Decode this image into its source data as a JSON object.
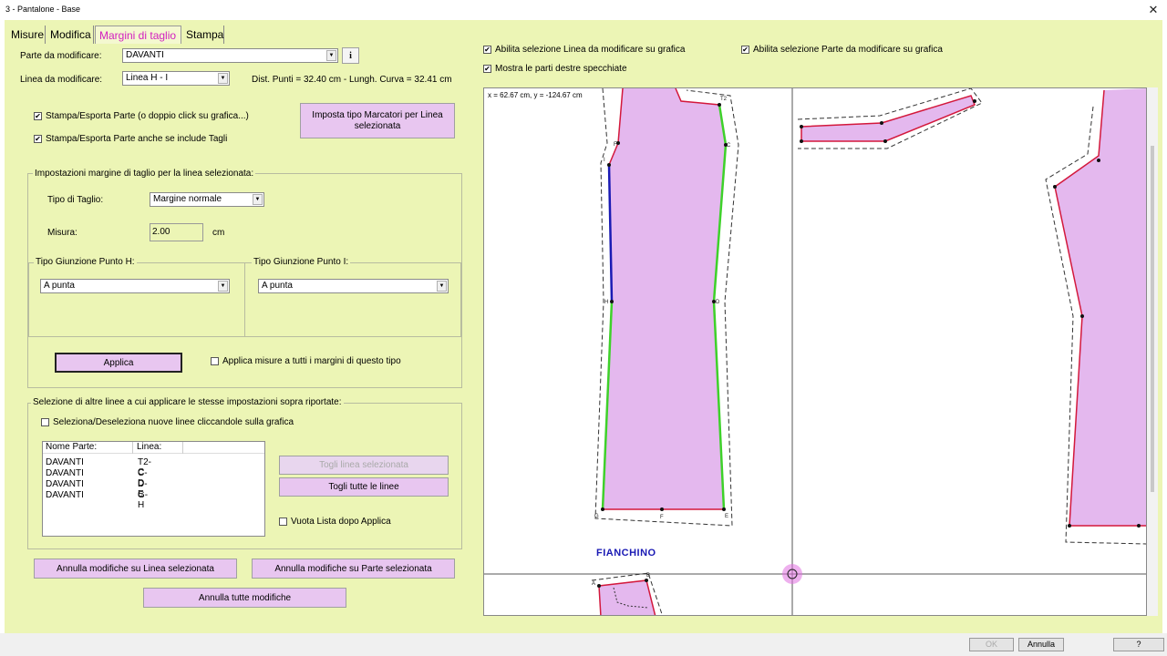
{
  "window": {
    "title": "3 - Pantalone - Base",
    "close_icon": "✕"
  },
  "tabs": [
    {
      "label": "Misure"
    },
    {
      "label": "Modifica"
    },
    {
      "label": "Margini di taglio"
    },
    {
      "label": "Stampa"
    }
  ],
  "part_select": {
    "label": "Parte da modificare:",
    "value": "DAVANTI",
    "info_icon": "i"
  },
  "line_select": {
    "label": "Linea da modificare:",
    "value": "Linea H - I",
    "dist_text": "Dist. Punti = 32.40 cm - Lungh. Curva = 32.41 cm"
  },
  "print_options": [
    {
      "label": "Stampa/Esporta Parte (o doppio click su grafica...)",
      "checked": "✔"
    },
    {
      "label": "Stampa/Esporta Parte anche se include Tagli",
      "checked": "✔"
    }
  ],
  "marker_button": "Imposta tipo Marcatori per Linea selezionata",
  "margin_group": {
    "title": "Impostazioni margine di taglio per la  linea selezionata:",
    "cut_type_label": "Tipo di Taglio:",
    "cut_type_value": "Margine normale",
    "measure_label": "Misura:",
    "measure_value": "2.00",
    "measure_unit": "cm",
    "joint_h_label": "Tipo Giunzione Punto H:",
    "joint_h_value": "A punta",
    "joint_i_label": "Tipo Giunzione Punto I:",
    "joint_i_value": "A punta",
    "apply_button": "Applica",
    "apply_all_label": "Applica misure a tutti i margini di questo tipo"
  },
  "lines_group": {
    "title": "Selezione di altre linee a cui applicare le stesse impostazioni sopra riportate:",
    "toggle_label": "Seleziona/Deseleziona nuove linee cliccandole sulla grafica",
    "col_part": "Nome Parte:",
    "col_line": "Linea:",
    "rows": [
      {
        "part": "DAVANTI",
        "line": "T2-C"
      },
      {
        "part": "DAVANTI",
        "line": "C-D"
      },
      {
        "part": "DAVANTI",
        "line": "D-E"
      },
      {
        "part": "DAVANTI",
        "line": "G-H"
      }
    ],
    "remove_selected": "Togli linea selezionata",
    "remove_all": "Togli tutte le linee",
    "empty_after_apply": "Vuota Lista dopo Applica"
  },
  "undo_line": "Annulla modifiche su Linea selezionata",
  "undo_part": "Annulla modifiche su Parte selezionata",
  "undo_all": "Annulla tutte modifiche",
  "canvas_options": [
    {
      "label": "Abilita selezione Linea da modificare su grafica",
      "checked": "✔"
    },
    {
      "label": "Abilita selezione Parte da modificare su grafica",
      "checked": "✔"
    },
    {
      "label": "Mostra le parti destre specchiate",
      "checked": "✔"
    }
  ],
  "canvas": {
    "coords": "x = 62.67 cm, y = -124.67 cm",
    "piece_label": "FIANCHINO",
    "points": {
      "T2": "T2",
      "F": "F",
      "I": "I",
      "C": "C",
      "H": "H",
      "D": "D",
      "G": "G",
      "E": "E",
      "A": "A",
      "B": "B"
    },
    "colors": {
      "fill": "#e4b8ee",
      "border": "#d3183c",
      "selected": "#1a1ab4",
      "highlight": "#3ed12a"
    }
  },
  "bottom": {
    "ok": "OK",
    "cancel": "Annulla",
    "help": "?"
  }
}
